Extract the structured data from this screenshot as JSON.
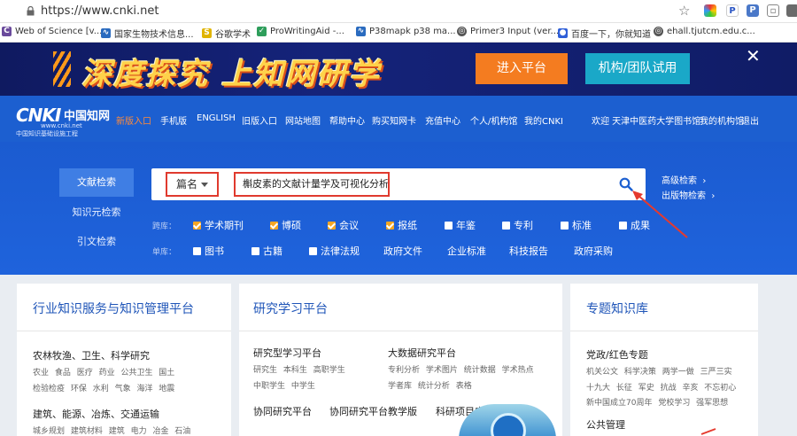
{
  "browser": {
    "url": "https://www.cnki.net",
    "bookmarks": [
      {
        "label": "Web of Science [v...",
        "icon": "wos-icon",
        "color": "#6a4a9c"
      },
      {
        "label": "国家生物技术信息...",
        "icon": "ncbi-icon",
        "color": "#2a6bbf"
      },
      {
        "label": "谷歌学术",
        "icon": "scholar-icon",
        "color": "#e0b400"
      },
      {
        "label": "ProWritingAid -...",
        "icon": "prowritingaid-icon",
        "color": "#2e9e5b"
      },
      {
        "label": "P38mapk p38 ma...",
        "icon": "p38-icon",
        "color": "#2a6bbf"
      },
      {
        "label": "Primer3 Input (ver...",
        "icon": "globe-icon",
        "color": "#555555"
      },
      {
        "label": "百度一下，你就知道",
        "icon": "baidu-icon",
        "color": "#2f5fd8"
      },
      {
        "label": "ehall.tjutcm.edu.c...",
        "icon": "globe-icon",
        "color": "#555555"
      }
    ]
  },
  "banner": {
    "slogan": "深度探究 上知网研学",
    "enter_label": "进入平台",
    "trial_label": "机构/团队试用",
    "close_glyph": "✕"
  },
  "header": {
    "logo_mark": "CNKI",
    "logo_cn": "中国知网",
    "logo_url": "www.cnki.net",
    "logo_sub": "中国知识基础设施工程",
    "nav": [
      "新版入口",
      "手机版",
      "ENGLISH",
      "旧版入口",
      "网站地图",
      "帮助中心",
      "购买知网卡",
      "充值中心",
      "个人/机构馆",
      "我的CNKI"
    ],
    "welcome": "欢迎 天津中医药大学图书馆!",
    "my_library": "我的机构馆",
    "logout": "退出"
  },
  "search": {
    "side_tabs": [
      "文献检索",
      "知识元检索",
      "引文检索"
    ],
    "field_label": "篇名",
    "query": "槲皮素的文献计量学及可视化分析",
    "advanced": "高级检索",
    "publication": "出版物检索",
    "cross_label": "跨库：",
    "single_label": "单库：",
    "cross_dbs": [
      {
        "label": "学术期刊",
        "checked": true
      },
      {
        "label": "博硕",
        "checked": true
      },
      {
        "label": "会议",
        "checked": true
      },
      {
        "label": "报纸",
        "checked": true
      },
      {
        "label": "年鉴",
        "checked": false
      },
      {
        "label": "专利",
        "checked": false
      },
      {
        "label": "标准",
        "checked": false
      },
      {
        "label": "成果",
        "checked": false
      }
    ],
    "single_dbs": [
      {
        "label": "图书",
        "checked": false
      },
      {
        "label": "古籍",
        "checked": false
      },
      {
        "label": "法律法规",
        "checked": false
      }
    ],
    "single_links": [
      "政府文件",
      "企业标准",
      "科技报告",
      "政府采购"
    ]
  },
  "cards": {
    "industry": {
      "title": "行业知识服务与知识管理平台",
      "s1_title": "农林牧渔、卫生、科学研究",
      "s1_tags1": "农业 食品 医疗 药业 公共卫生 国土",
      "s1_tags2": "检验检疫 环保 水利 气象 海洋 地震",
      "s2_title": "建筑、能源、冶炼、交通运输",
      "s2_tags": "城乡规划 建筑材料 建筑 电力 冶金 石油"
    },
    "research": {
      "title": "研究学习平台",
      "c1_title": "研究型学习平台",
      "c1_tags1": "研究生 本科生 高职学生",
      "c1_tags2": "中职学生 中学生",
      "c2_title": "大数据研究平台",
      "c2_tags1": "专利分析 学术图片 统计数据 学术热点",
      "c2_tags2": "学者库 统计分析 表格",
      "link1": "协同研究平台",
      "link2": "协同研究平台教学版",
      "link3": "科研项目申报信息库"
    },
    "topic": {
      "title": "专题知识库",
      "s1_title": "党政/红色专题",
      "s1_tags1": "机关公文 科学决策 两学一做 三严三实",
      "s1_tags2": "十九大 长征 军史 抗战 辛亥 不忘初心",
      "s1_tags3": "新中国成立70周年 党校学习 强军思想",
      "s2_title": "公共管理"
    }
  }
}
